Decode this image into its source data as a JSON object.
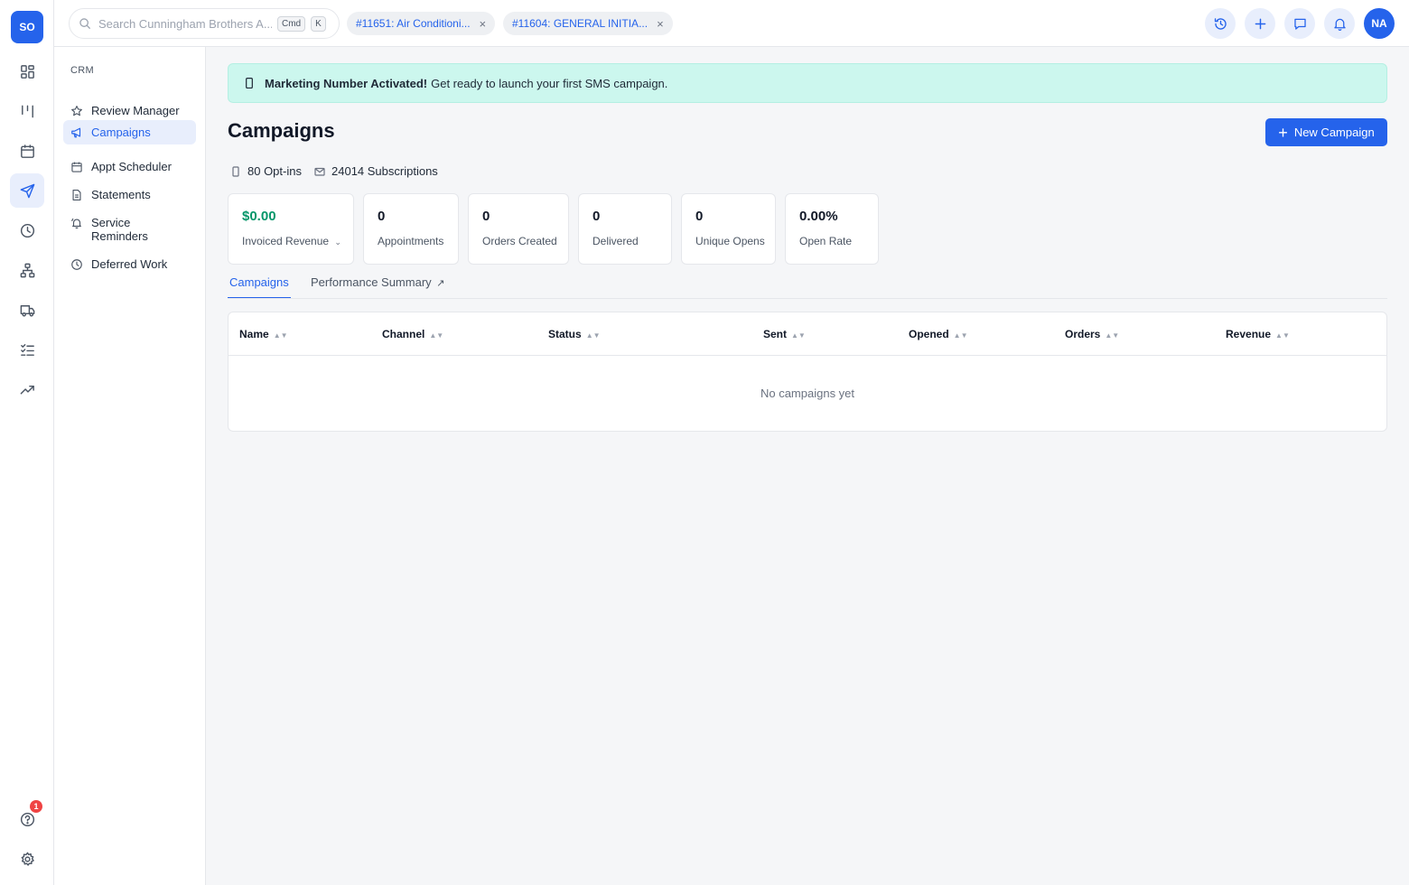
{
  "rail": {
    "logo": "SO",
    "help_badge": "1"
  },
  "topbar": {
    "search_placeholder": "Search Cunningham Brothers A...",
    "kbd_cmd": "Cmd",
    "kbd_k": "K",
    "chips": [
      {
        "label": "#11651: Air Conditioni..."
      },
      {
        "label": "#11604: GENERAL INITIA..."
      }
    ],
    "avatar": "NA"
  },
  "sidebar": {
    "section": "CRM",
    "items": [
      {
        "label": "Review Manager"
      },
      {
        "label": "Campaigns"
      },
      {
        "label": "Appt Scheduler"
      },
      {
        "label": "Statements"
      },
      {
        "label": "Service Reminders"
      },
      {
        "label": "Deferred Work"
      }
    ]
  },
  "banner": {
    "bold": "Marketing Number Activated!",
    "text": "Get ready to launch your first SMS campaign."
  },
  "page": {
    "title": "Campaigns",
    "new_button": "New Campaign",
    "optins": "80 Opt-ins",
    "subscriptions": "24014 Subscriptions"
  },
  "stats": [
    {
      "value": "$0.00",
      "label": "Invoiced Revenue"
    },
    {
      "value": "0",
      "label": "Appointments"
    },
    {
      "value": "0",
      "label": "Orders Created"
    },
    {
      "value": "0",
      "label": "Delivered"
    },
    {
      "value": "0",
      "label": "Unique Opens"
    },
    {
      "value": "0.00%",
      "label": "Open Rate"
    }
  ],
  "tabs": [
    {
      "label": "Campaigns"
    },
    {
      "label": "Performance Summary"
    }
  ],
  "table": {
    "columns": [
      "Name",
      "Channel",
      "Status",
      "Sent",
      "Opened",
      "Orders",
      "Revenue"
    ],
    "empty": "No campaigns yet"
  },
  "colors": {
    "accent": "#2563eb",
    "banner_bg": "#ccf7ee",
    "revenue_green": "#059669"
  }
}
